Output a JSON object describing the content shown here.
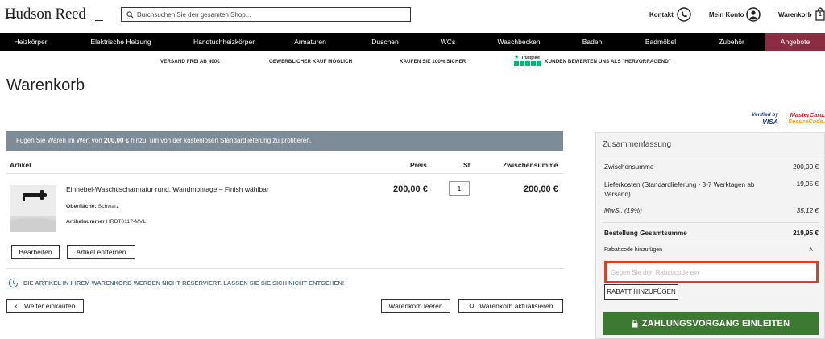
{
  "header": {
    "logo": "Hudson Reed",
    "search_placeholder": "Durchsuchen Sie den gesamten Shop...",
    "contact": "Kontakt",
    "account": "Mein Konto",
    "cart": "Warenkorb",
    "cart_count": "1"
  },
  "nav": {
    "items": [
      "Heizkörper",
      "Elektrische Heizung",
      "Handtuchheizkörper",
      "Armaturen",
      "Duschen",
      "WCs",
      "Waschbecken",
      "Baden",
      "Badmöbel",
      "Zubehör",
      "Angebote"
    ]
  },
  "usp": {
    "items": [
      "VERSAND FREI AB 400€",
      "GEWERBLICHER KAUF MÖGLICH",
      "KAUFEN SIE 100% SICHER",
      "KUNDEN BEWERTEN UNS ALS \"HERVORRAGEND\""
    ],
    "trustpilot": "Trustpilot"
  },
  "page_title": "Warenkorb",
  "payment": {
    "visa_top": "Verified by",
    "visa_bottom": "VISA",
    "mc_top": "MasterCard.",
    "mc_bottom": "SecureCode."
  },
  "banner": {
    "pre": "Fügen Sie Waren im Wert von ",
    "amount": "200,00 €",
    "post": " hinzu, um von der kostenlosen Standardlieferung zu profitieren."
  },
  "table": {
    "headers": {
      "item": "Artikel",
      "price": "Preis",
      "qty": "St",
      "subtotal": "Zwischensumme"
    },
    "row": {
      "name": "Einhebel-Waschtischarmatur rund, Wandmontage – Finish wählbar",
      "finish_label": "Oberfläche:",
      "finish_value": "Schwarz",
      "sku_label": "Artikelnummer",
      "sku_value": "HRBT0117-MVL",
      "price": "200,00 €",
      "qty": "1",
      "subtotal": "200,00 €"
    },
    "edit": "Bearbeiten",
    "remove": "Artikel entfernen"
  },
  "notice": "DIE ARTIKEL IN IHREM WARENKORB WERDEN NICHT RESERVIERT. LASSEN SIE SIE SICH NICHT ENTGEHEN!",
  "actions": {
    "continue": "Weiter einkaufen",
    "clear": "Warenkorb leeren",
    "update": "Warenkorb aktualisieren"
  },
  "summary": {
    "title": "Zusammenfassung",
    "subtotal_label": "Zwischensumme",
    "subtotal_value": "200,00 €",
    "shipping_label": "Lieferkosten (Standardlieferung - 3-7 Werktagen ab Versand)",
    "shipping_value": "19,95 €",
    "vat_label": "MwSt. (19%)",
    "vat_value": "35,12 €",
    "total_label": "Bestellung Gesamtsumme",
    "total_value": "219,95 €",
    "coupon_toggle": "Rabattcode hinzufügen",
    "coupon_placeholder": "Geben Sie den Rabattcode ein",
    "coupon_button": "RABATT HINZUFÜGEN",
    "checkout": "ZAHLUNGSVORGANG EINLEITEN"
  },
  "colors": {
    "nav_bg": "#000000",
    "offer_bg": "#8c2c43",
    "banner_bg": "#7e8c98",
    "checkout_bg": "#3d7a31",
    "coupon_border": "#e53a24"
  }
}
